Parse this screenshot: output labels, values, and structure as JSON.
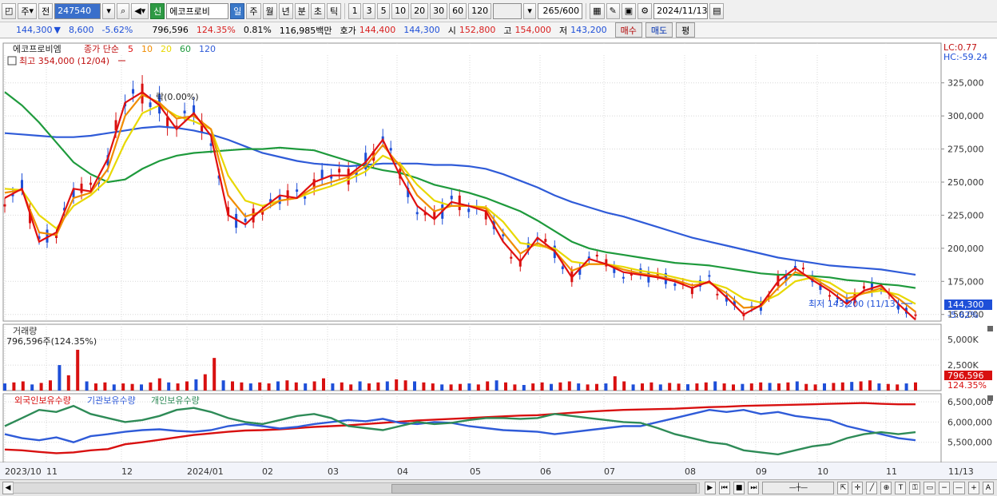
{
  "toolbar": {
    "period_week": "주",
    "prev_label": "전",
    "stock_code": "247540",
    "sin_badge": "신",
    "stock_name": "에코프로비",
    "period_tabs": [
      "일",
      "주",
      "월",
      "년",
      "분",
      "초",
      "틱"
    ],
    "interval_buttons": [
      "1",
      "3",
      "5",
      "10",
      "20",
      "30",
      "60",
      "120"
    ],
    "count_value": "265",
    "count_total": "/600",
    "date_value": "2024/11/13"
  },
  "info": {
    "price": "144,300",
    "change": "8,600",
    "change_pct": "-5.62%",
    "volume": "796,596",
    "volume_ratio": "124.35%",
    "turnover": "0.81%",
    "amount": "116,985백만",
    "bid_label": "호가",
    "ask_price": "144,400",
    "bid_price": "144,300",
    "open_label": "시",
    "open": "152,800",
    "high_label": "고",
    "high": "154,000",
    "low_label": "저",
    "low": "143,200",
    "buy_button": "매수",
    "sell_button": "매도",
    "eval_button": "평"
  },
  "price_panel": {
    "stock_name": "에코프로비엠",
    "ma_prefix": "종가 단순",
    "ma_legend": [
      {
        "label": "5",
        "color": "#e01010"
      },
      {
        "label": "10",
        "color": "#f08c00"
      },
      {
        "label": "20",
        "color": "#e8d800"
      },
      {
        "label": "60",
        "color": "#1e9a3c"
      },
      {
        "label": "120",
        "color": "#2f5bd8"
      }
    ],
    "high_note": "최고 354,000 (12/04)",
    "low_note": "최저 143,200 (11/13)",
    "mid_note": "락(0.00%)",
    "lc": "LC:0.77",
    "hc": "HC:-59.24",
    "current_price": "144,300",
    "current_pct": "-5.62%"
  },
  "volume_panel": {
    "title": "거래량",
    "value_note": "796,596주(124.35%)",
    "current": "796,596",
    "pct": "124.35%"
  },
  "holdings_panel": {
    "legend": [
      {
        "label": "외국인보유수량",
        "color": "#d81010"
      },
      {
        "label": "기관보유수량",
        "color": "#2f5bd8"
      },
      {
        "label": "개인보유수량",
        "color": "#2e8b57"
      }
    ]
  },
  "chart_data": [
    {
      "type": "line",
      "title": "에코프로비엠",
      "ylim": [
        145000,
        355000
      ],
      "y_ticks": [
        "150,000",
        "175,000",
        "200,000",
        "225,000",
        "250,000",
        "275,000",
        "300,000",
        "325,000"
      ],
      "x_ticks": [
        "2023/10",
        "11",
        "12",
        "2024/01",
        "02",
        "03",
        "04",
        "05",
        "06",
        "07",
        "08",
        "09",
        "10",
        "11",
        "11/13"
      ],
      "series": [
        {
          "name": "5",
          "color": "#e01010",
          "values": [
            238000,
            245000,
            205000,
            212000,
            245000,
            243000,
            268000,
            310000,
            318000,
            308000,
            290000,
            302000,
            285000,
            225000,
            218000,
            230000,
            240000,
            238000,
            250000,
            255000,
            255000,
            265000,
            282000,
            255000,
            232000,
            222000,
            235000,
            232000,
            228000,
            205000,
            190000,
            208000,
            198000,
            178000,
            192000,
            188000,
            182000,
            180000,
            178000,
            175000,
            170000,
            175000,
            163000,
            150000,
            157000,
            175000,
            185000,
            176000,
            168000,
            158000,
            168000,
            172000,
            158000,
            146000
          ]
        },
        {
          "name": "10",
          "color": "#f08c00",
          "values": [
            242000,
            244000,
            212000,
            210000,
            238000,
            242000,
            260000,
            300000,
            316000,
            310000,
            298000,
            300000,
            290000,
            240000,
            224000,
            228000,
            236000,
            238000,
            246000,
            250000,
            254000,
            262000,
            278000,
            262000,
            240000,
            228000,
            232000,
            232000,
            230000,
            212000,
            196000,
            204000,
            198000,
            183000,
            188000,
            188000,
            184000,
            181000,
            179000,
            176000,
            172000,
            174000,
            166000,
            155000,
            156000,
            170000,
            182000,
            178000,
            170000,
            162000,
            166000,
            170000,
            162000,
            152000
          ]
        },
        {
          "name": "20",
          "color": "#e8d800",
          "values": [
            245000,
            244000,
            225000,
            215000,
            232000,
            240000,
            252000,
            280000,
            302000,
            308000,
            300000,
            296000,
            290000,
            255000,
            236000,
            232000,
            236000,
            238000,
            243000,
            247000,
            252000,
            258000,
            270000,
            264000,
            248000,
            236000,
            232000,
            232000,
            231000,
            220000,
            204000,
            202000,
            200000,
            190000,
            188000,
            188000,
            186000,
            183000,
            181000,
            178000,
            175000,
            174000,
            170000,
            162000,
            159000,
            165000,
            175000,
            178000,
            174000,
            166000,
            166000,
            168000,
            165000,
            158000
          ]
        },
        {
          "name": "60",
          "color": "#1e9a3c",
          "values": [
            318000,
            308000,
            295000,
            280000,
            265000,
            256000,
            250000,
            252000,
            260000,
            266000,
            270000,
            272000,
            273000,
            274000,
            275000,
            275000,
            276000,
            275000,
            274000,
            270000,
            266000,
            262000,
            259000,
            257000,
            253000,
            248000,
            245000,
            242000,
            238000,
            233000,
            228000,
            221000,
            213000,
            205000,
            200000,
            197000,
            195000,
            193000,
            191000,
            189000,
            188000,
            187000,
            185000,
            183000,
            181000,
            180000,
            180000,
            179000,
            178000,
            176000,
            175000,
            173000,
            172000,
            170000
          ]
        },
        {
          "name": "120",
          "color": "#2f5bd8",
          "values": [
            287000,
            286000,
            285000,
            284000,
            284000,
            285000,
            287000,
            289000,
            291000,
            292000,
            291000,
            289000,
            286000,
            282000,
            277000,
            272000,
            269000,
            266000,
            264000,
            263000,
            262000,
            263000,
            264000,
            264000,
            264000,
            263000,
            263000,
            262000,
            260000,
            256000,
            251000,
            246000,
            240000,
            235000,
            231000,
            227000,
            224000,
            220000,
            216000,
            212000,
            208000,
            205000,
            202000,
            199000,
            196000,
            193000,
            191000,
            189000,
            187000,
            186000,
            185000,
            184000,
            182000,
            180000
          ]
        }
      ]
    },
    {
      "type": "bar",
      "title": "거래량",
      "ylim": [
        0,
        6500
      ],
      "y_ticks": [
        "2,500K",
        "5,000K"
      ],
      "values": [
        700,
        800,
        900,
        600,
        750,
        1000,
        2500,
        1500,
        4000,
        900,
        700,
        800,
        600,
        700,
        650,
        600,
        800,
        1200,
        800,
        700,
        900,
        1100,
        1600,
        3200,
        1000,
        900,
        800,
        700,
        800,
        700,
        900,
        1000,
        800,
        700,
        900,
        1200,
        700,
        800,
        600,
        900,
        700,
        800,
        900,
        1100,
        1000,
        900,
        800,
        700,
        600,
        600,
        650,
        700,
        600,
        900,
        1000,
        800,
        600,
        550,
        700,
        800,
        650,
        800,
        900,
        700,
        600,
        650,
        700,
        1400,
        900,
        600,
        700,
        800,
        600,
        750,
        680,
        620,
        700,
        800,
        900,
        700,
        600,
        650,
        700,
        800,
        750,
        700,
        800,
        900,
        650,
        600,
        700,
        750,
        800,
        850,
        900,
        1000,
        700,
        650,
        600,
        700,
        800
      ]
    },
    {
      "type": "line",
      "title": "보유수량",
      "ylim": [
        5000000,
        6700000
      ],
      "y_ticks": [
        "5,500,000",
        "6,000,000",
        "6,500,000"
      ],
      "series": [
        {
          "name": "외국인보유수량",
          "color": "#d81010",
          "values": [
            5320000,
            5300000,
            5260000,
            5230000,
            5250000,
            5300000,
            5330000,
            5450000,
            5500000,
            5560000,
            5620000,
            5680000,
            5720000,
            5760000,
            5790000,
            5800000,
            5820000,
            5850000,
            5880000,
            5900000,
            5920000,
            5950000,
            5980000,
            6010000,
            6040000,
            6060000,
            6080000,
            6100000,
            6120000,
            6140000,
            6160000,
            6170000,
            6200000,
            6230000,
            6260000,
            6280000,
            6300000,
            6310000,
            6320000,
            6330000,
            6350000,
            6370000,
            6380000,
            6400000,
            6410000,
            6420000,
            6430000,
            6440000,
            6450000,
            6460000,
            6470000,
            6450000,
            6440000,
            6440000
          ]
        },
        {
          "name": "기관보유수량",
          "color": "#2f5bd8",
          "values": [
            5700000,
            5600000,
            5550000,
            5620000,
            5500000,
            5650000,
            5700000,
            5760000,
            5800000,
            5820000,
            5780000,
            5760000,
            5800000,
            5900000,
            5950000,
            5900000,
            5840000,
            5880000,
            5950000,
            6000000,
            6050000,
            6020000,
            6080000,
            5980000,
            5950000,
            6000000,
            5980000,
            5900000,
            5850000,
            5800000,
            5780000,
            5760000,
            5700000,
            5750000,
            5800000,
            5850000,
            5900000,
            5900000,
            6000000,
            6100000,
            6200000,
            6300000,
            6250000,
            6300000,
            6200000,
            6250000,
            6150000,
            6100000,
            6050000,
            5900000,
            5800000,
            5700000,
            5600000,
            5550000
          ]
        },
        {
          "name": "개인보유수량",
          "color": "#2e8b57",
          "values": [
            5900000,
            6100000,
            6300000,
            6250000,
            6400000,
            6200000,
            6100000,
            6000000,
            6050000,
            6150000,
            6300000,
            6350000,
            6250000,
            6100000,
            6000000,
            5950000,
            6050000,
            6150000,
            6200000,
            6100000,
            5900000,
            5850000,
            5800000,
            5900000,
            6000000,
            5950000,
            5980000,
            6050000,
            6100000,
            6100000,
            6080000,
            6100000,
            6200000,
            6150000,
            6100000,
            6050000,
            6000000,
            5980000,
            5850000,
            5700000,
            5600000,
            5500000,
            5450000,
            5300000,
            5250000,
            5200000,
            5300000,
            5400000,
            5450000,
            5600000,
            5700000,
            5750000,
            5700000,
            5750000
          ]
        }
      ]
    }
  ]
}
